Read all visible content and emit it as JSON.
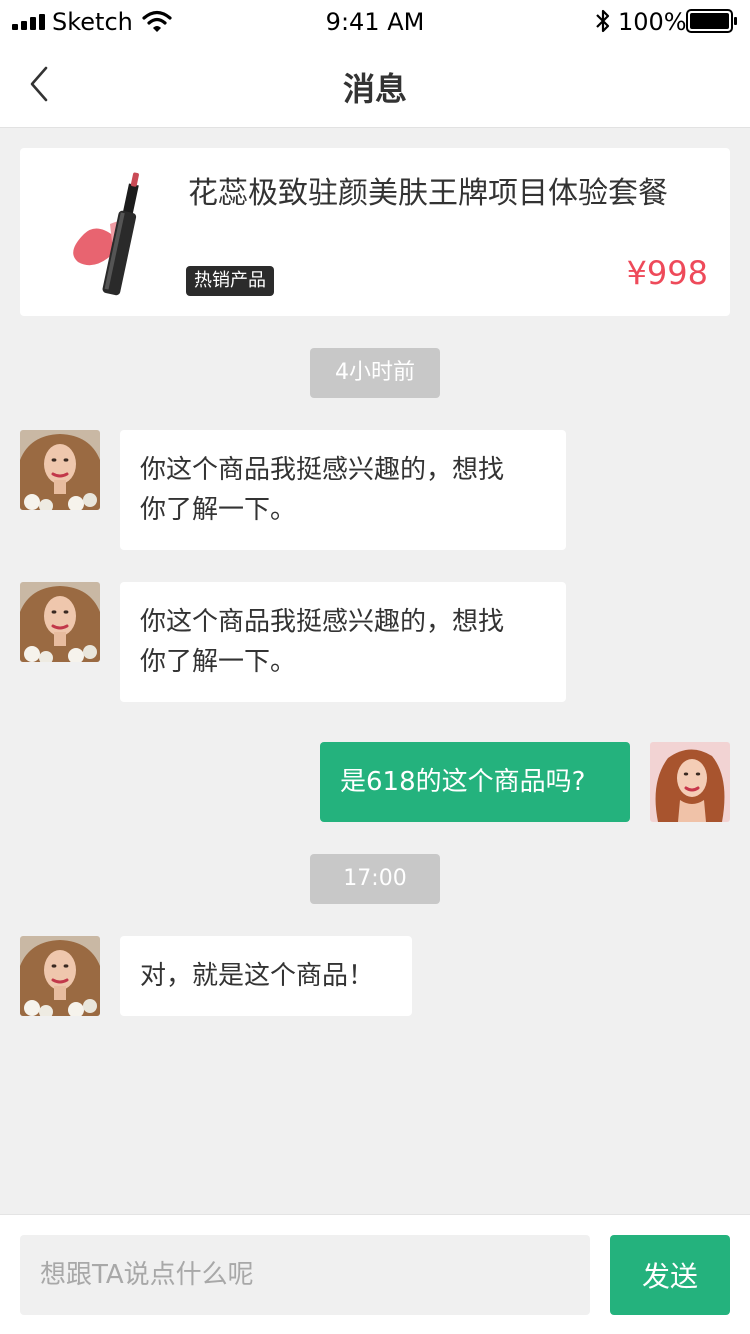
{
  "status_bar": {
    "carrier": "Sketch",
    "time": "9:41 AM",
    "battery": "100%",
    "icons": [
      "signal-icon",
      "wifi-icon",
      "bluetooth-icon",
      "battery-icon"
    ]
  },
  "nav": {
    "title": "消息",
    "back_icon": "chevron-left-icon"
  },
  "product": {
    "title": "花蕊极致驻颜美肤王牌项目体验套餐",
    "badge": "热销产品",
    "price": "¥998",
    "image": "lipstick-product-image"
  },
  "chat": {
    "time_1": "4小时前",
    "time_2": "17:00",
    "messages": [
      {
        "side": "them",
        "line1": "你这个商品我挺感兴趣的，想找",
        "line2": "你了解一下。"
      },
      {
        "side": "them",
        "line1": "你这个商品我挺感兴趣的，想找",
        "line2": "你了解一下。"
      },
      {
        "side": "me",
        "text": "是618的这个商品吗?"
      },
      {
        "side": "them",
        "text": "对，就是这个商品！"
      }
    ]
  },
  "input_bar": {
    "placeholder": "想跟TA说点什么呢",
    "send_label": "发送"
  },
  "colors": {
    "accent_green": "#24b27d",
    "price_red": "#ee4a5a",
    "background": "#f0f0f0",
    "time_chip": "#c8c8c8"
  }
}
